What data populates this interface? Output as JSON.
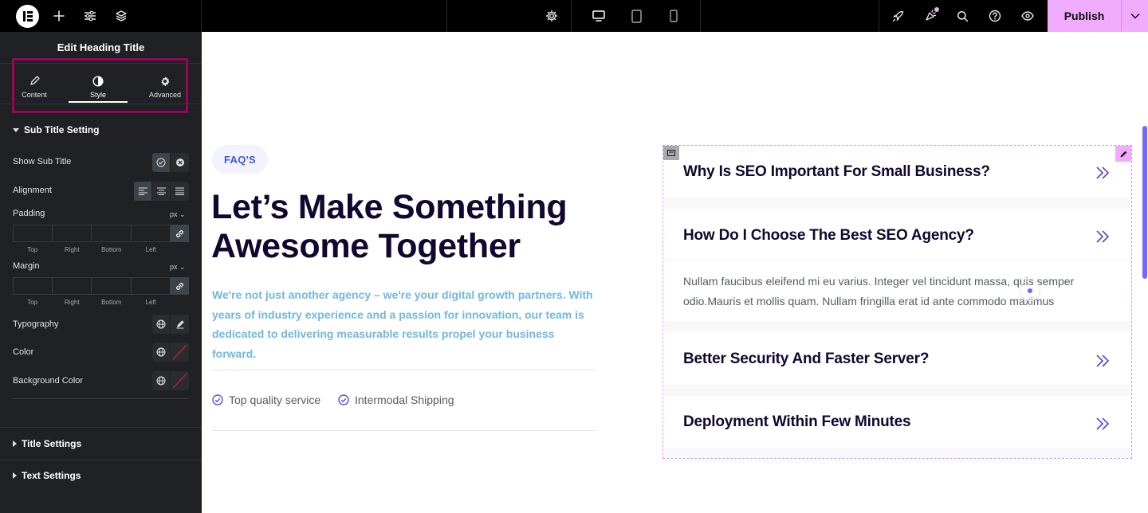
{
  "topbar": {
    "publish_label": "Publish",
    "icons": [
      "elementor-logo-icon",
      "add-icon",
      "settings-sliders-icon",
      "layers-icon",
      "site-settings-gear-icon",
      "desktop-icon",
      "tablet-icon",
      "mobile-icon",
      "rocket-icon",
      "notifications-icon",
      "search-icon",
      "help-icon",
      "preview-eye-icon",
      "chevron-down-icon"
    ],
    "accent_color": "#f0abfc"
  },
  "panel": {
    "title": "Edit Heading Title",
    "tabs": [
      {
        "label": "Content",
        "icon": "pencil-icon"
      },
      {
        "label": "Style",
        "icon": "half-circle-icon"
      },
      {
        "label": "Advanced",
        "icon": "gear-icon"
      }
    ],
    "active_tab": "Style",
    "sections": {
      "sub_title_setting": "Sub Title Setting",
      "title_settings": "Title Settings",
      "text_settings": "Text Settings"
    },
    "controls": {
      "show_sub_title": "Show Sub Title",
      "alignment": "Alignment",
      "padding": "Padding",
      "margin": "Margin",
      "typography": "Typography",
      "color": "Color",
      "background_color": "Background Color",
      "unit": "px",
      "dims": [
        "Top",
        "Right",
        "Bottom",
        "Left"
      ]
    },
    "highlight_color": "#a1005f"
  },
  "content": {
    "pill": "FAQ'S",
    "title_line1": "Let’s Make Something",
    "title_line2": "Awesome Together",
    "description": "We're not just another agency – we're your digital growth partners. With years of industry experience and a passion for innovation, our team is dedicated to delivering measurable results propel your business forward.",
    "features": [
      "Top quality service",
      "Intermodal Shipping"
    ]
  },
  "faq": {
    "items": [
      {
        "question": "Why Is SEO Important For Small Business?"
      },
      {
        "question": "How Do I Choose The Best SEO Agency?",
        "answer": "Nullam faucibus eleifend mi eu varius. Integer vel tincidunt massa, quis semper odio.Mauris et mollis quam. Nullam fringilla erat id ante commodo maximus"
      },
      {
        "question": "Better Security And Faster Server?"
      },
      {
        "question": "Deployment Within Few Minutes"
      }
    ]
  }
}
